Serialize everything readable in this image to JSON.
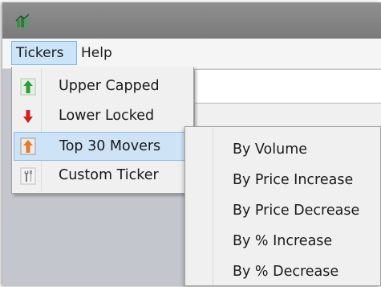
{
  "menubar": {
    "items": [
      {
        "label": "Tickers",
        "active": true
      },
      {
        "label": "Help",
        "active": false
      }
    ]
  },
  "tickers_menu": {
    "items": [
      {
        "label": "Upper Capped",
        "icon": "arrow-up-green-icon",
        "has_submenu": false
      },
      {
        "label": "Lower Locked",
        "icon": "arrow-down-red-icon",
        "has_submenu": false
      },
      {
        "label": "Top 30 Movers",
        "icon": "top-movers-orange-icon",
        "has_submenu": true,
        "highlighted": true
      },
      {
        "label": "Custom Ticker",
        "icon": "wrench-icon",
        "has_submenu": false
      }
    ]
  },
  "top_movers_submenu": {
    "items": [
      {
        "label": "By Volume"
      },
      {
        "label": "By Price Increase"
      },
      {
        "label": "By Price Decrease"
      },
      {
        "label": "By % Increase"
      },
      {
        "label": "By % Decrease"
      }
    ]
  },
  "colors": {
    "titlebar": "#808080",
    "menubar": "#f5f5f5",
    "menu_bg": "#f0f0f0",
    "highlight": "#cfe3f6",
    "highlight_border": "#8fbbe6",
    "up_green": "#2e9e3a",
    "down_red": "#d21f1f",
    "mover_orange": "#e8772a"
  }
}
